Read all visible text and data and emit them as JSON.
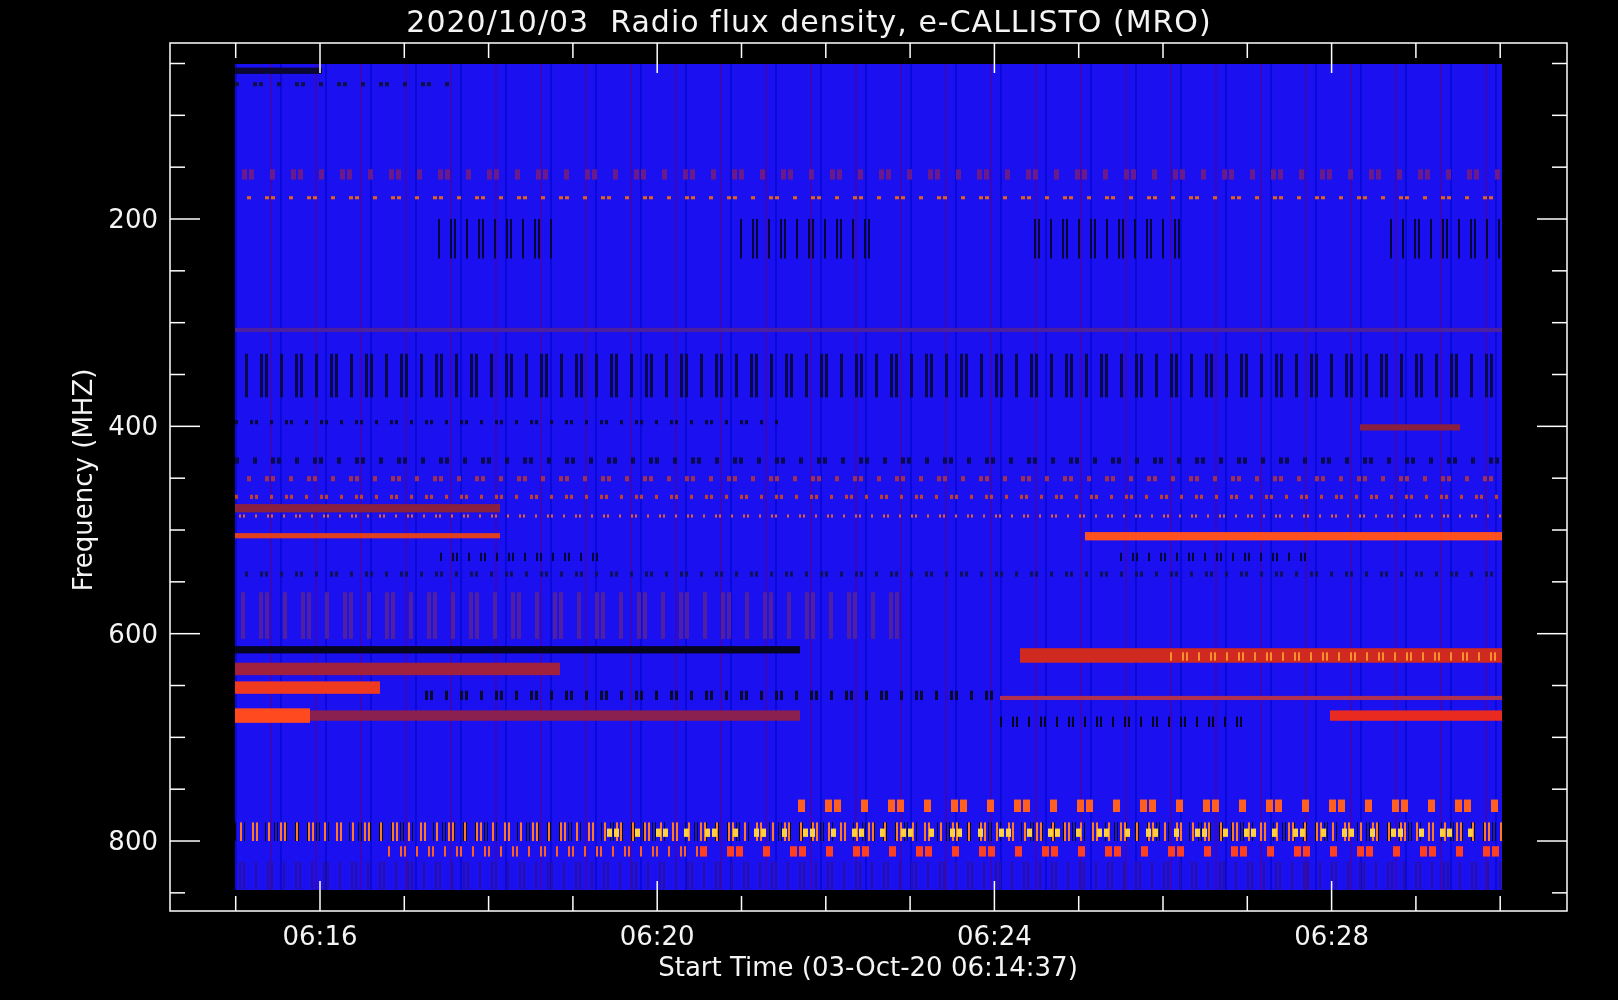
{
  "title": "2020/10/03  Radio flux density, e-CALLISTO (MRO)",
  "y_axis": {
    "label": "Frequency (MHZ)",
    "ticks": [
      "200",
      "400",
      "600",
      "800"
    ]
  },
  "x_axis": {
    "label": "Start Time (03-Oct-20 06:14:37)",
    "ticks": [
      "06:16",
      "06:20",
      "06:24",
      "06:28"
    ]
  }
}
